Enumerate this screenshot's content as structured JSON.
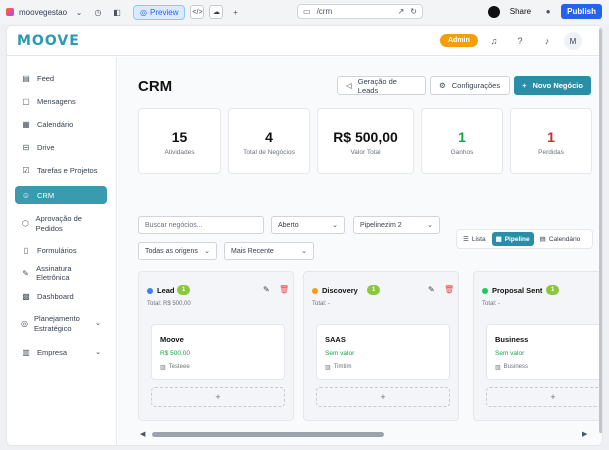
{
  "browser": {
    "project_name": "moovegestao",
    "preview_label": "Preview",
    "url": "/crm",
    "share_label": "Share",
    "publish_label": "Publish"
  },
  "header": {
    "logo_text": "MOOVE",
    "admin_badge": "Admin",
    "avatar_initial": "M"
  },
  "sidebar": {
    "items": [
      {
        "label": "Feed",
        "icon": "feed-icon"
      },
      {
        "label": "Mensagens",
        "icon": "message-icon"
      },
      {
        "label": "Calendário",
        "icon": "calendar-icon"
      },
      {
        "label": "Drive",
        "icon": "drive-icon"
      },
      {
        "label": "Tarefas e Projetos",
        "icon": "tasks-icon"
      },
      {
        "label": "CRM",
        "icon": "users-icon",
        "active": true
      },
      {
        "label": "Aprovação de Pedidos",
        "icon": "package-icon"
      },
      {
        "label": "Formulários",
        "icon": "form-icon"
      },
      {
        "label": "Assinatura Eletrônica",
        "icon": "signature-icon"
      },
      {
        "label": "Dashboard",
        "icon": "dashboard-icon"
      },
      {
        "label": "Planejamento Estratégico",
        "icon": "target-icon",
        "expandable": true
      },
      {
        "label": "Empresa",
        "icon": "building-icon",
        "expandable": true
      }
    ]
  },
  "page": {
    "title": "CRM",
    "actions": {
      "leads": "Geração de Leads",
      "settings": "Configurações",
      "new_deal": "Novo Negócio"
    }
  },
  "stats": [
    {
      "value": "15",
      "label": "Atividades"
    },
    {
      "value": "4",
      "label": "Total de Negócios"
    },
    {
      "value": "R$ 500,00",
      "label": "Valor Total"
    },
    {
      "value": "1",
      "label": "Ganhos"
    },
    {
      "value": "1",
      "label": "Perdidas"
    }
  ],
  "filters": {
    "search_placeholder": "Buscar negócios...",
    "status": "Aberto",
    "pipeline": "Pipelinezim 2",
    "origin": "Todas as origens",
    "sort": "Mais Recente"
  },
  "views": {
    "list": "Lista",
    "pipeline": "Pipeline",
    "calendar": "Calendário",
    "active": "pipeline"
  },
  "columns": [
    {
      "name": "Lead",
      "count": "1",
      "color": "#3b82f6",
      "total": "Total: R$ 500,00",
      "deal": {
        "title": "Moove",
        "value": "R$ 500,00",
        "owner": "Testeee"
      }
    },
    {
      "name": "Discovery",
      "count": "1",
      "color": "#f59e0b",
      "total": "Total: -",
      "deal": {
        "title": "SAAS",
        "value": "Sem valor",
        "owner": "Timtim"
      }
    },
    {
      "name": "Proposal Sent",
      "count": "1",
      "color": "#22c55e",
      "total": "Total: -",
      "deal": {
        "title": "Business",
        "value": "Sem valor",
        "owner": "Business"
      }
    }
  ],
  "add_card_label": "+"
}
